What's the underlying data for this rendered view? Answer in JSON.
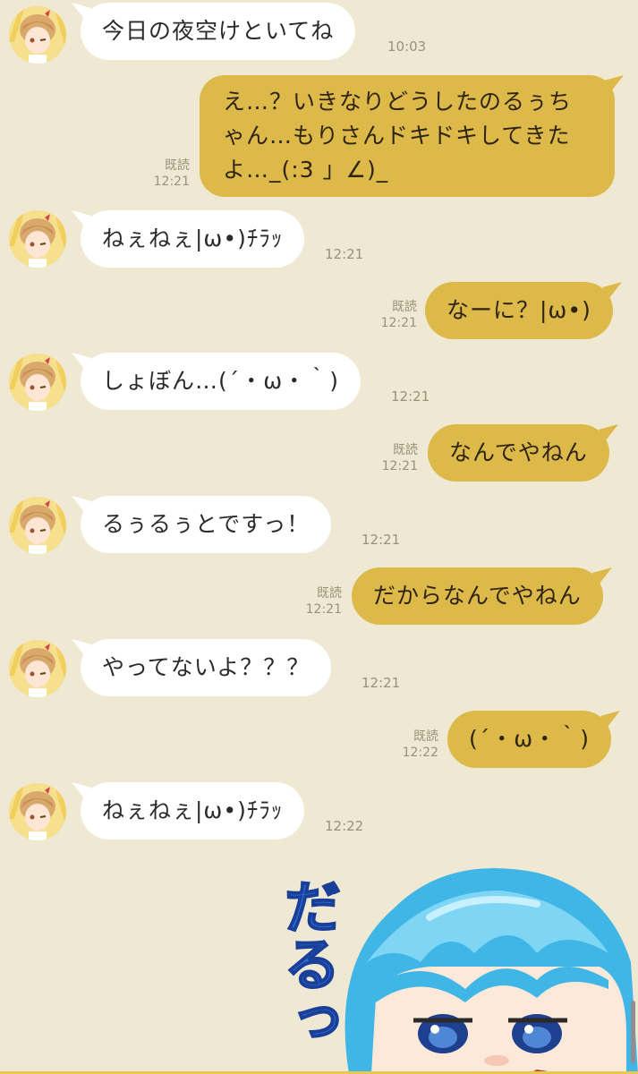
{
  "conversation": {
    "read_label": "既読",
    "messages": [
      {
        "side": "in",
        "text": "今日の夜空けといてね",
        "time": "10:03"
      },
      {
        "side": "out",
        "text": "え…？いきなりどうしたのるぅちゃん…もりさんドキドキしてきたよ…_(:3 」∠)_",
        "time": "12:21",
        "read": "既読"
      },
      {
        "side": "in",
        "text": "ねぇねぇ|ω•)ﾁﾗｯ",
        "time": "12:21"
      },
      {
        "side": "out",
        "text": "なーに？|ω•)",
        "time": "12:21",
        "read": "既読"
      },
      {
        "side": "in",
        "text": "しょぼん…(´・ω・｀)",
        "time": "12:21"
      },
      {
        "side": "out",
        "text": "なんでやねん",
        "time": "12:21",
        "read": "既読"
      },
      {
        "side": "in",
        "text": "るぅるぅとですっ！",
        "time": "12:21"
      },
      {
        "side": "out",
        "text": "だからなんでやねん",
        "time": "12:21",
        "read": "既読"
      },
      {
        "side": "in",
        "text": "やってないよ？？？",
        "time": "12:21"
      },
      {
        "side": "out",
        "text": "(´・ω・｀)",
        "time": "12:22",
        "read": "既読"
      },
      {
        "side": "in",
        "text": "ねぇねぇ|ω•)ﾁﾗｯ",
        "time": "12:22"
      }
    ]
  },
  "sticker": {
    "text": "だるっ",
    "icon": "character-sticker"
  },
  "colors": {
    "background": "#efe9d4",
    "incoming_bubble": "#ffffff",
    "outgoing_bubble": "#ddb94a",
    "timestamp": "#9a917a"
  }
}
